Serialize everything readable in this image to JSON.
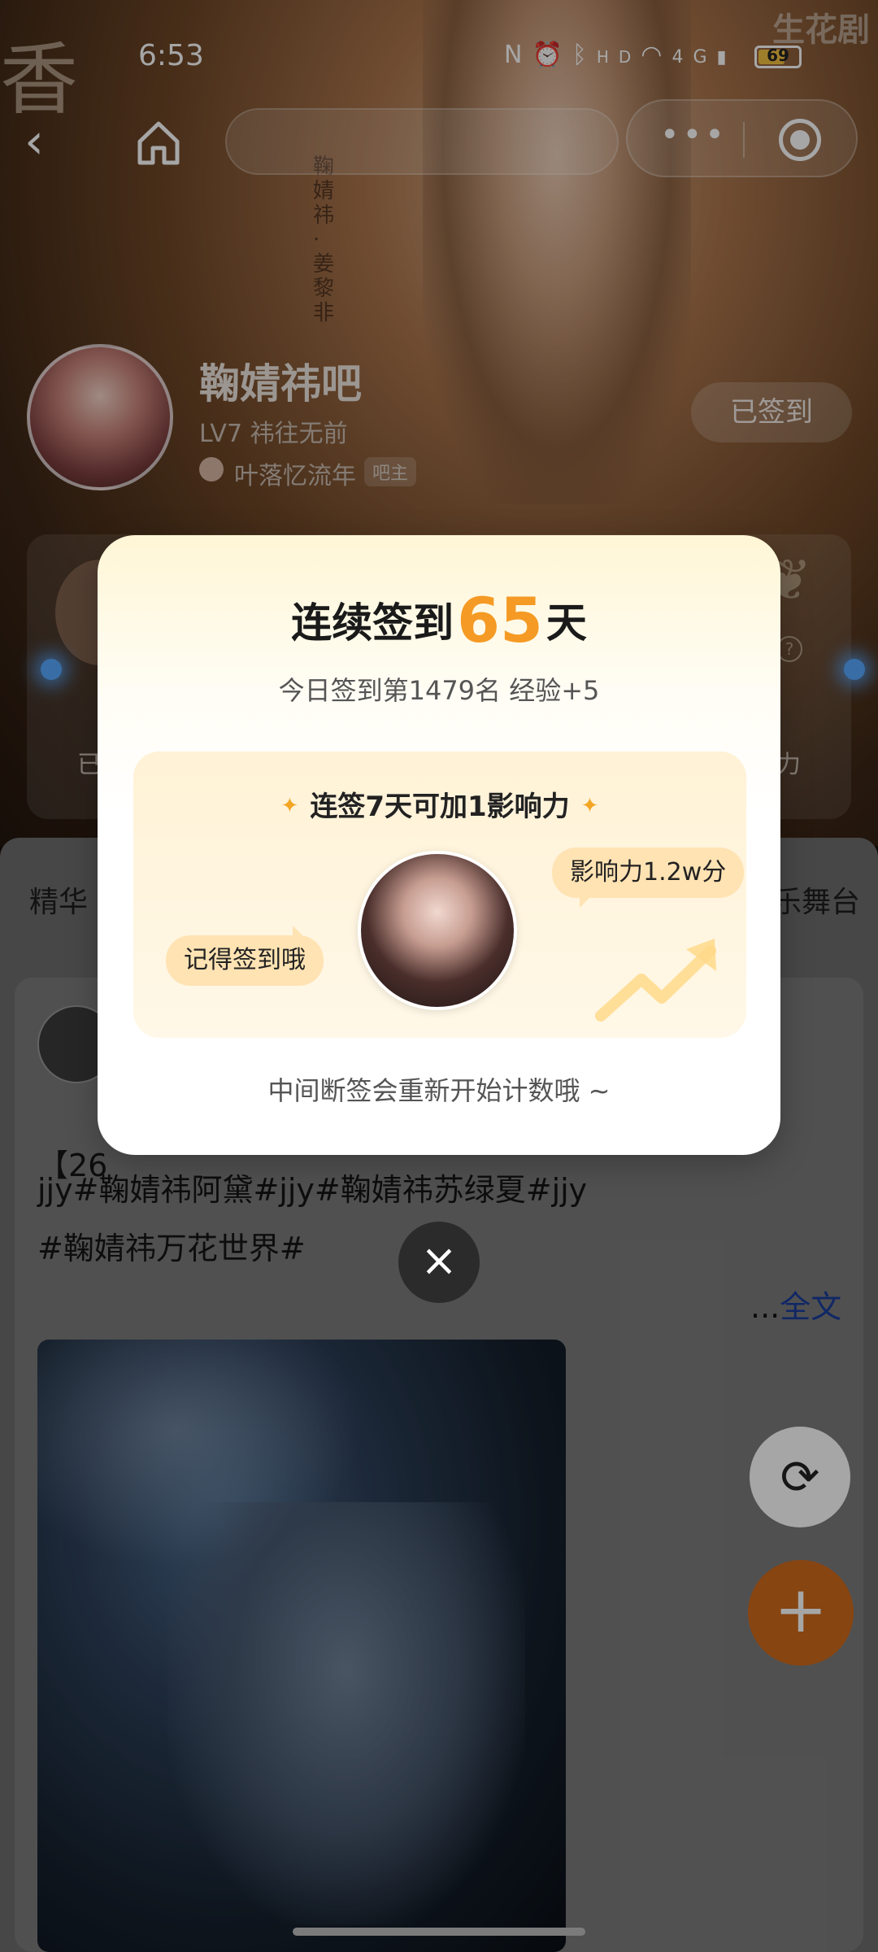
{
  "status_bar": {
    "time": "6:53",
    "icons": [
      "nfc-icon",
      "alarm-icon",
      "bluetooth-icon",
      "hd-icon",
      "wifi-icon",
      "signal-4g-icon"
    ],
    "battery": 69
  },
  "watermark": {
    "right": "生花剧"
  },
  "nav": {
    "capsule_more": "•••"
  },
  "poster_vertical_text": "鞠婧祎 · 姜黎非",
  "forum": {
    "name": "鞠婧祎吧",
    "level": "LV7 祎往无前",
    "owner": "叶落忆流年",
    "owner_badge": "吧主",
    "signed_button": "已签到"
  },
  "background_card": {
    "left_text": "已",
    "right_text": "力"
  },
  "tabs": {
    "left": "精华",
    "right": "乐舞台"
  },
  "post": {
    "line1": "【26",
    "line2": "jjy#鞠婧祎阿黛#jjy#鞠婧祎苏绿夏#jjy",
    "line3": "#鞠婧祎万花世界#",
    "read_more_prefix": "...",
    "read_more": "全文"
  },
  "modal": {
    "title_prefix": "连续签到",
    "days": "65",
    "title_suffix": "天",
    "subtitle": "今日签到第1479名 经验+5",
    "panel_title": "连签7天可加1影响力",
    "bubble_left": "记得签到哦",
    "bubble_right": "影响力1.2w分",
    "footnote": "中间断签会重新开始计数哦 ~",
    "close": "×"
  },
  "fab": {
    "refresh": "⟳",
    "add": "+"
  },
  "colors": {
    "accent": "#f59a24",
    "fab_orange": "#cf6a1d",
    "link": "#1a3d9c"
  }
}
